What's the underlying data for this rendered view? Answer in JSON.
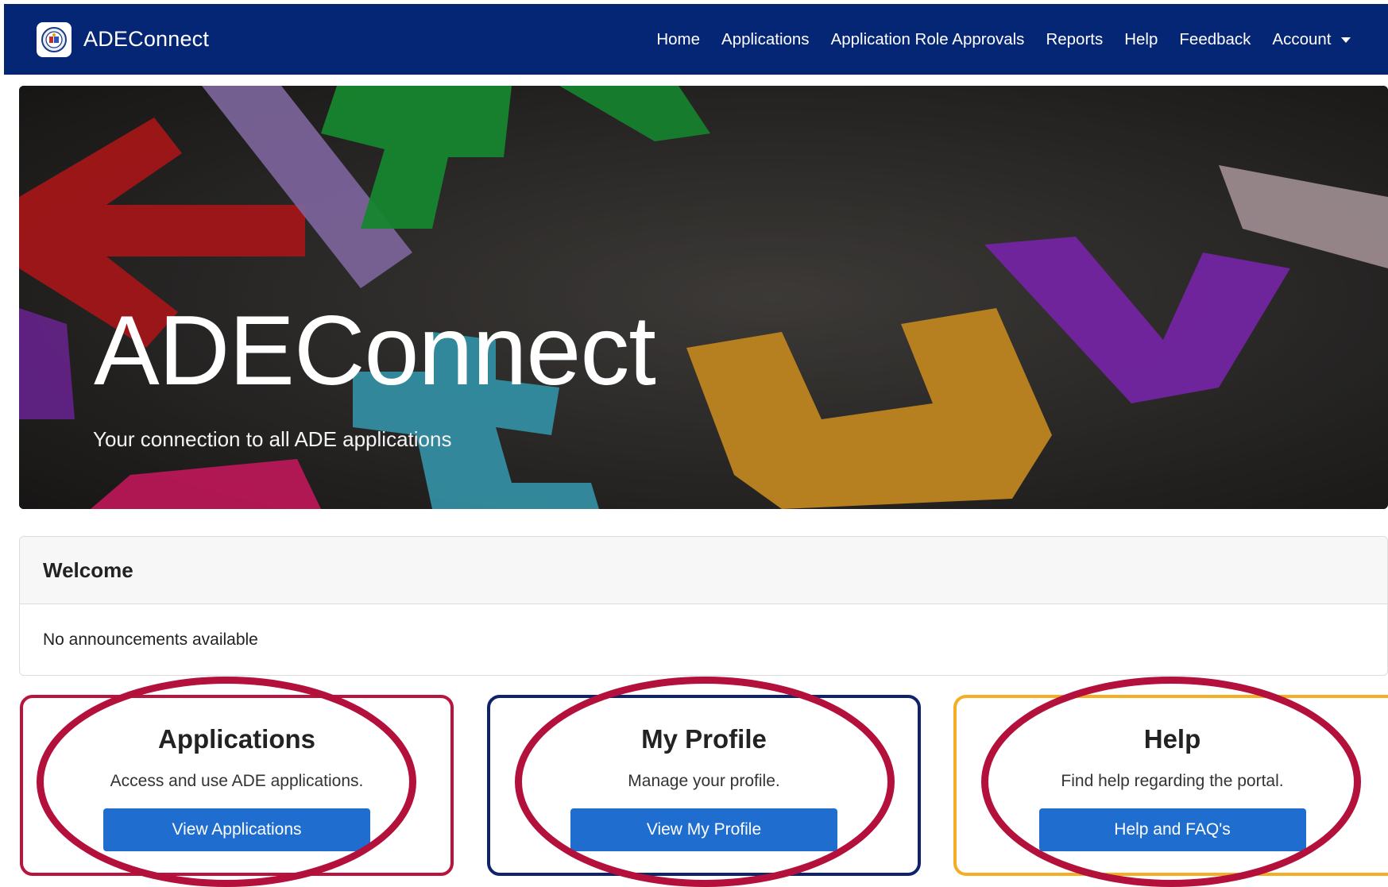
{
  "navbar": {
    "brand": "ADEConnect",
    "links": [
      "Home",
      "Applications",
      "Application Role Approvals",
      "Reports",
      "Help",
      "Feedback"
    ],
    "account_label": "Account"
  },
  "hero": {
    "title": "ADEConnect",
    "subtitle": "Your connection to all ADE applications"
  },
  "welcome": {
    "title": "Welcome",
    "announcement": "No announcements available"
  },
  "tiles": [
    {
      "title": "Applications",
      "description": "Access and use ADE applications.",
      "button": "View Applications",
      "color": "#b9143d"
    },
    {
      "title": "My Profile",
      "description": "Manage your profile.",
      "button": "View My Profile",
      "color": "#0f236a"
    },
    {
      "title": "Help",
      "description": "Find help regarding the portal.",
      "button": "Help and FAQ's",
      "color": "#f4ae25"
    }
  ],
  "colors": {
    "navbar": "#052575",
    "button": "#1f6ecf",
    "annotation": "#b4103c"
  }
}
